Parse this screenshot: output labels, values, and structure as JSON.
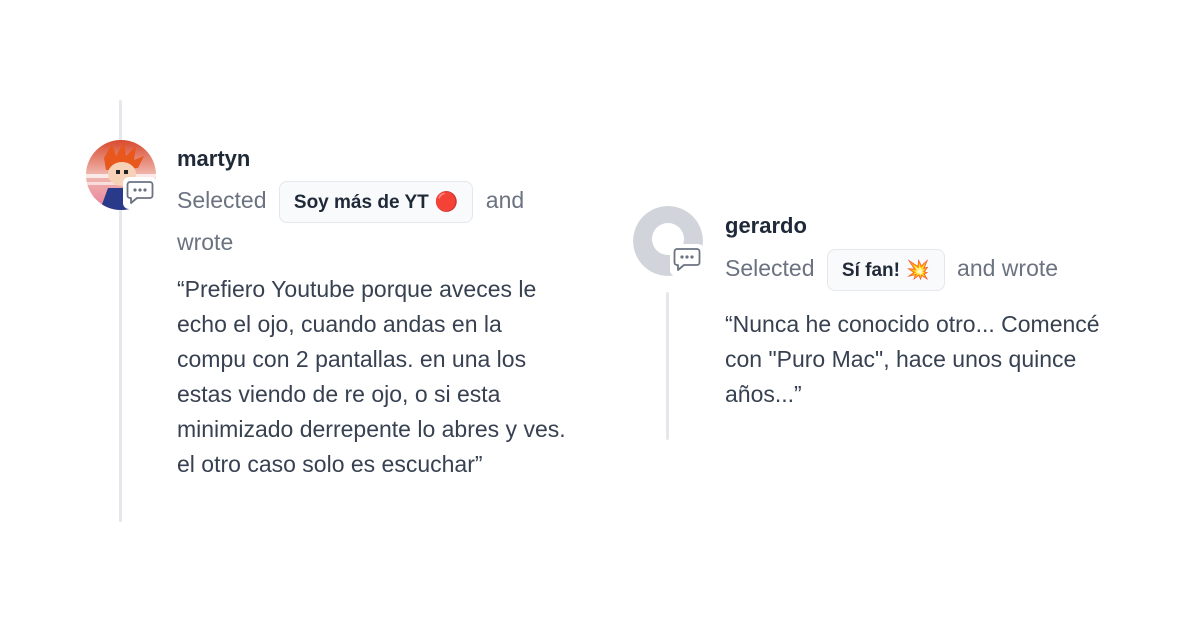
{
  "comments": [
    {
      "username": "martyn",
      "selected_prefix": "Selected",
      "option_label": "Soy más de YT",
      "option_emoji": "🔴",
      "selected_suffix_1": "and",
      "selected_suffix_2": "wrote",
      "quote": "“Prefiero Youtube porque aveces le echo el ojo, cuando andas en la compu con 2 pantallas. en una los estas viendo de re ojo, o si esta minimizado derrepente lo abres y ves. el otro caso solo es escuchar”",
      "avatar_icon": "user-photo-avatar",
      "badge_icon": "comment-bubble-icon"
    },
    {
      "username": "gerardo",
      "selected_prefix": "Selected",
      "option_label": "Sí fan!",
      "option_emoji": "💥",
      "selected_suffix": "and wrote",
      "quote": "“Nunca he conocido otro... Comencé con \"Puro Mac\", hace unos quince años...”",
      "avatar_icon": "default-user-avatar",
      "badge_icon": "comment-bubble-icon"
    }
  ],
  "colors": {
    "thread_line": "#e5e7eb",
    "muted_text": "#6b7280",
    "body_text": "#374151",
    "pill_bg": "#f9fafb",
    "pill_border": "#e5e7eb"
  }
}
